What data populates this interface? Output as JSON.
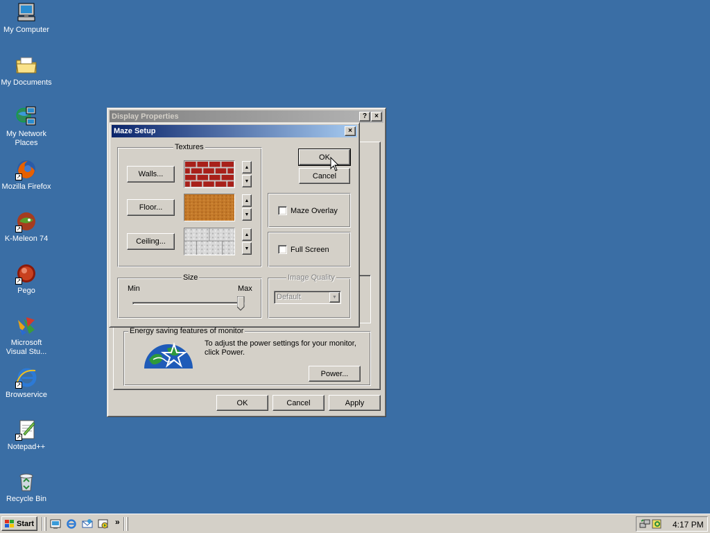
{
  "desktop": {
    "icons": [
      {
        "label": "My Computer",
        "icon": "computer-icon"
      },
      {
        "label": "My Documents",
        "icon": "folder-icon"
      },
      {
        "label": "My Network Places",
        "icon": "network-icon"
      },
      {
        "label": "Mozilla Firefox",
        "icon": "firefox-icon"
      },
      {
        "label": "K-Meleon 74",
        "icon": "kmeleon-icon"
      },
      {
        "label": "Pego",
        "icon": "pego-icon"
      },
      {
        "label": "Microsoft Visual Stu...",
        "icon": "visual-studio-icon"
      },
      {
        "label": "Browservice",
        "icon": "internet-explorer-icon"
      },
      {
        "label": "Notepad++",
        "icon": "notepad-icon"
      },
      {
        "label": "Recycle Bin",
        "icon": "recycle-bin-icon"
      }
    ]
  },
  "display_properties": {
    "title": "Display Properties",
    "help_btn": "?",
    "close_btn": "×",
    "energy_group": "Energy saving features of monitor",
    "energy_text": "To adjust the power settings for your monitor, click Power.",
    "power_button": "Power...",
    "ok": "OK",
    "cancel": "Cancel",
    "apply": "Apply"
  },
  "maze_setup": {
    "title": "Maze Setup",
    "close_btn": "×",
    "textures_group": "Textures",
    "walls_button": "Walls...",
    "floor_button": "Floor...",
    "ceiling_button": "Ceiling...",
    "size_group": "Size",
    "size_min": "Min",
    "size_max": "Max",
    "size_value": 1.0,
    "ok": "OK",
    "cancel": "Cancel",
    "maze_overlay": "Maze Overlay",
    "maze_overlay_checked": false,
    "full_screen": "Full Screen",
    "full_screen_checked": false,
    "image_quality_group": "Image Quality",
    "image_quality_value": "Default"
  },
  "taskbar": {
    "start": "Start",
    "chevron": "»",
    "clock": "4:17 PM"
  }
}
